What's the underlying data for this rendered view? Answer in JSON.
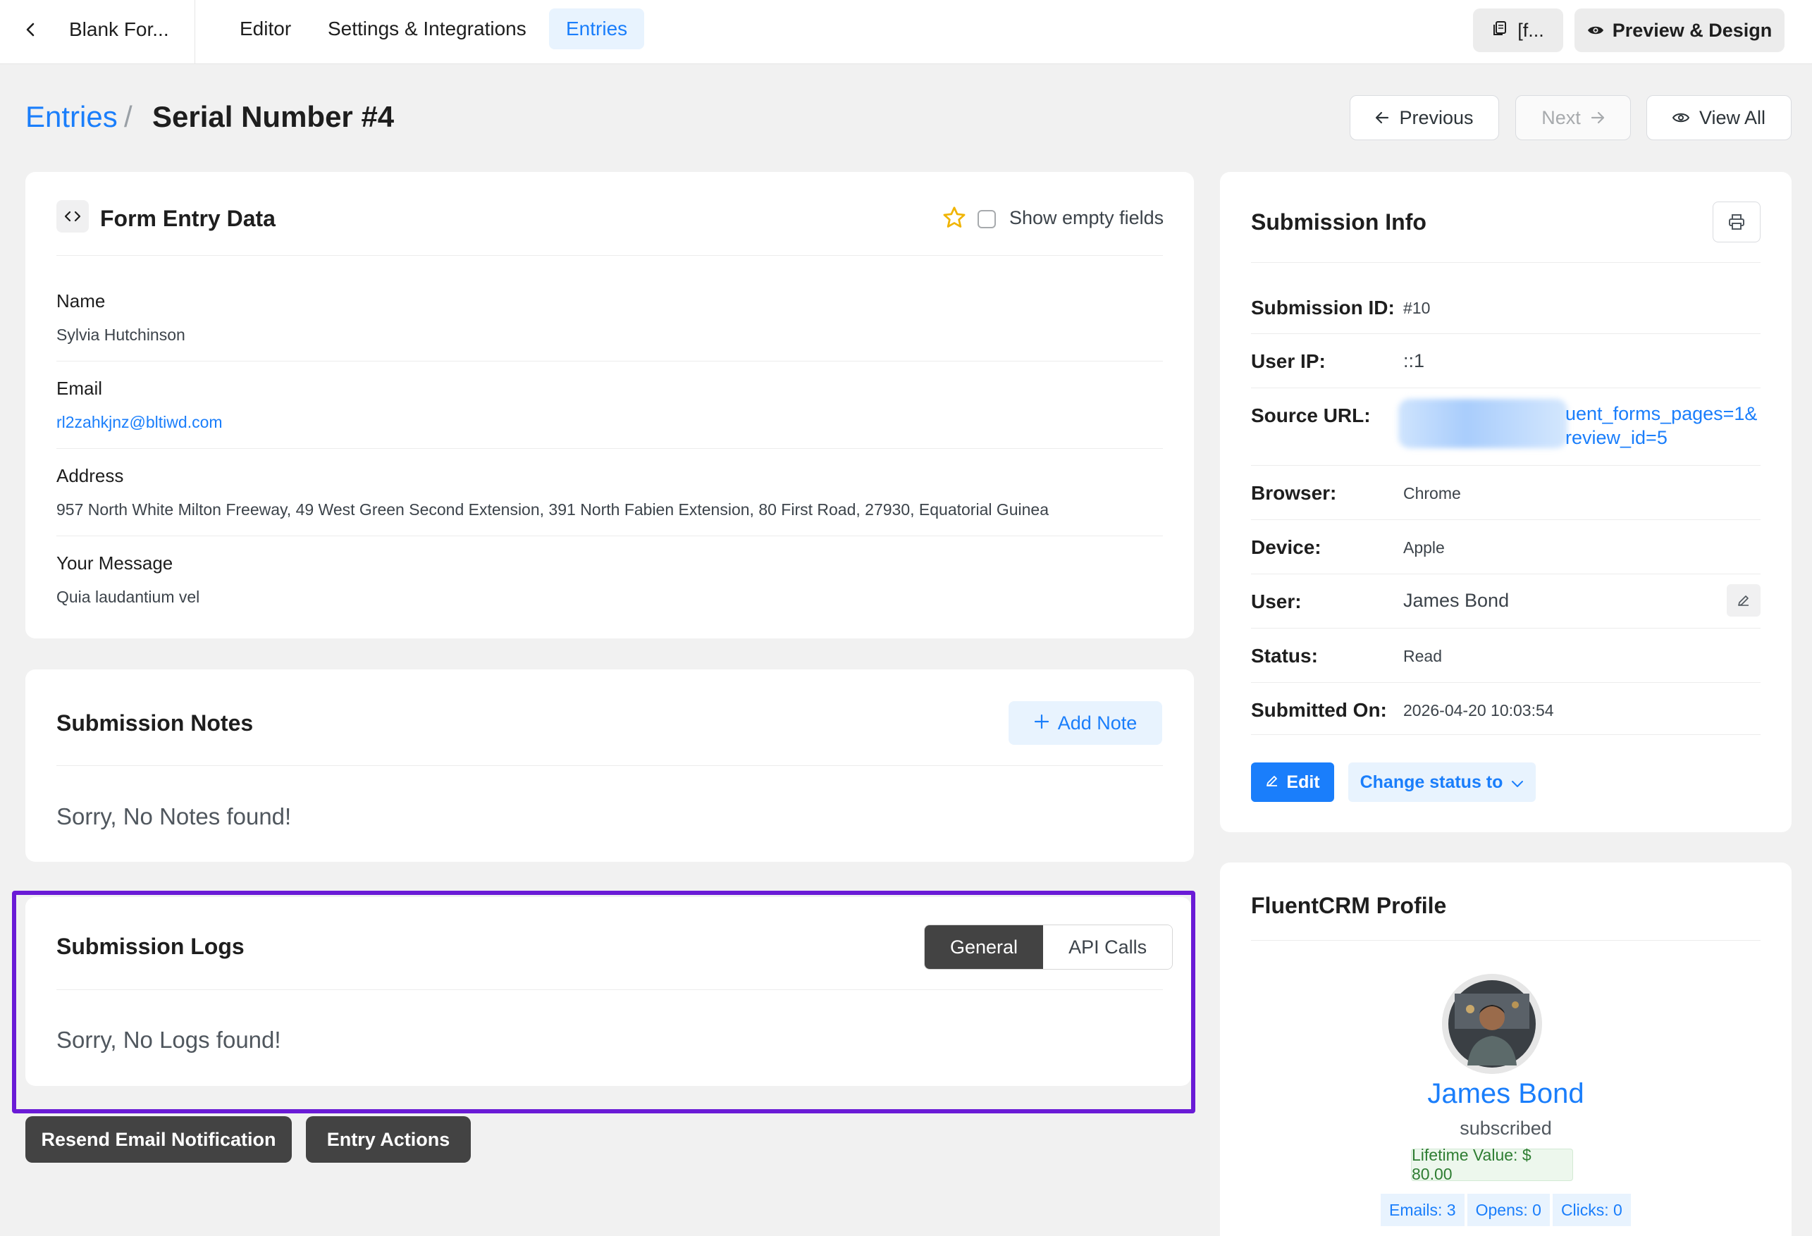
{
  "topbar": {
    "form_title": "Blank For...",
    "tabs": [
      {
        "label": "Editor"
      },
      {
        "label": "Settings & Integrations"
      },
      {
        "label": "Entries"
      }
    ],
    "shortcode_label": "[f...",
    "preview_label": "Preview & Design"
  },
  "breadcrumb": {
    "parent": "Entries",
    "separator": "/",
    "title": "Serial Number #4"
  },
  "pagination": {
    "previous": "Previous",
    "next": "Next",
    "view_all": "View All"
  },
  "entry": {
    "title": "Form Entry Data",
    "show_empty_label": "Show empty fields",
    "fields": [
      {
        "label": "Name",
        "value": "Sylvia Hutchinson"
      },
      {
        "label": "Email",
        "value": "rl2zahkjnz@bltiwd.com"
      },
      {
        "label": "Address",
        "value": "957 North White Milton Freeway, 49 West Green Second Extension, 391 North Fabien Extension, 80 First Road, 27930, Equatorial Guinea"
      },
      {
        "label": "Your Message",
        "value": "Quia laudantium vel"
      }
    ]
  },
  "notes": {
    "title": "Submission Notes",
    "add_label": "Add Note",
    "empty": "Sorry, No Notes found!"
  },
  "logs": {
    "title": "Submission Logs",
    "tabs": [
      {
        "label": "General",
        "active": true
      },
      {
        "label": "API Calls",
        "active": false
      }
    ],
    "empty": "Sorry, No Logs found!"
  },
  "actions": {
    "resend": "Resend Email Notification",
    "entry_actions": "Entry Actions"
  },
  "submission_info": {
    "title": "Submission Info",
    "rows": [
      {
        "label": "Submission ID:",
        "value": "#10"
      },
      {
        "label": "User IP:",
        "value": "::1"
      },
      {
        "label": "Source URL:",
        "value_line1": "uent_forms_pages=1&",
        "value_line2": "review_id=5"
      },
      {
        "label": "Browser:",
        "value": "Chrome"
      },
      {
        "label": "Device:",
        "value": "Apple"
      },
      {
        "label": "User:",
        "value": "James Bond"
      },
      {
        "label": "Status:",
        "value": "Read"
      },
      {
        "label": "Submitted On:",
        "value": "2026-04-20 10:03:54"
      }
    ],
    "edit_label": "Edit",
    "change_status_label": "Change status to"
  },
  "crm": {
    "title": "FluentCRM Profile",
    "name": "James Bond",
    "status": "subscribed",
    "lifetime_value": "Lifetime Value: $ 80.00",
    "stats": [
      {
        "label": "Emails: 3"
      },
      {
        "label": "Opens: 0"
      },
      {
        "label": "Clicks: 0"
      }
    ]
  },
  "colors": {
    "accent": "#1a7efb",
    "highlight_border": "#6a1bd6",
    "dark_button": "#434343"
  }
}
